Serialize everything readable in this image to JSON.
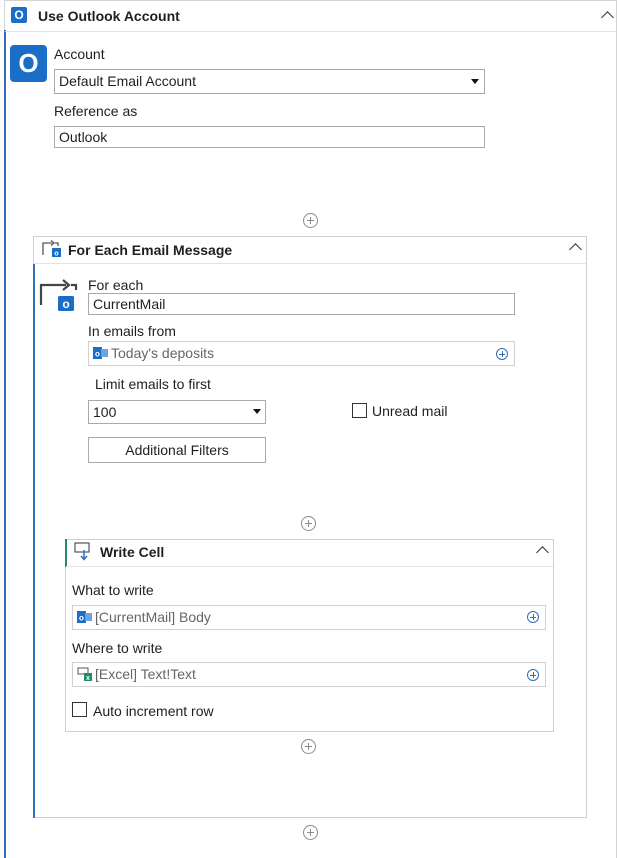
{
  "outlook_block": {
    "title": "Use Outlook Account",
    "account_label": "Account",
    "account_value": "Default Email Account",
    "reference_label": "Reference as",
    "reference_value": "Outlook"
  },
  "foreach_block": {
    "title": "For Each Email Message",
    "for_each_label": "For each",
    "for_each_value": "CurrentMail",
    "emails_from_label": "In emails from",
    "emails_from_value": "Today's deposits",
    "limit_label": "Limit emails to first",
    "limit_value": "100",
    "unread_label": "Unread mail",
    "filters_button": "Additional Filters"
  },
  "write_block": {
    "title": "Write Cell",
    "what_label": "What to write",
    "what_value": "[CurrentMail] Body",
    "where_label": "Where to write",
    "where_value": "[Excel] Text!Text",
    "auto_increment_label": "Auto increment row"
  },
  "icons": {
    "outlook_logo_letter": "O",
    "outlook_color": "#1a6ec7",
    "accent_blue": "#2e6fb7",
    "accent_green": "#1f8f62"
  }
}
